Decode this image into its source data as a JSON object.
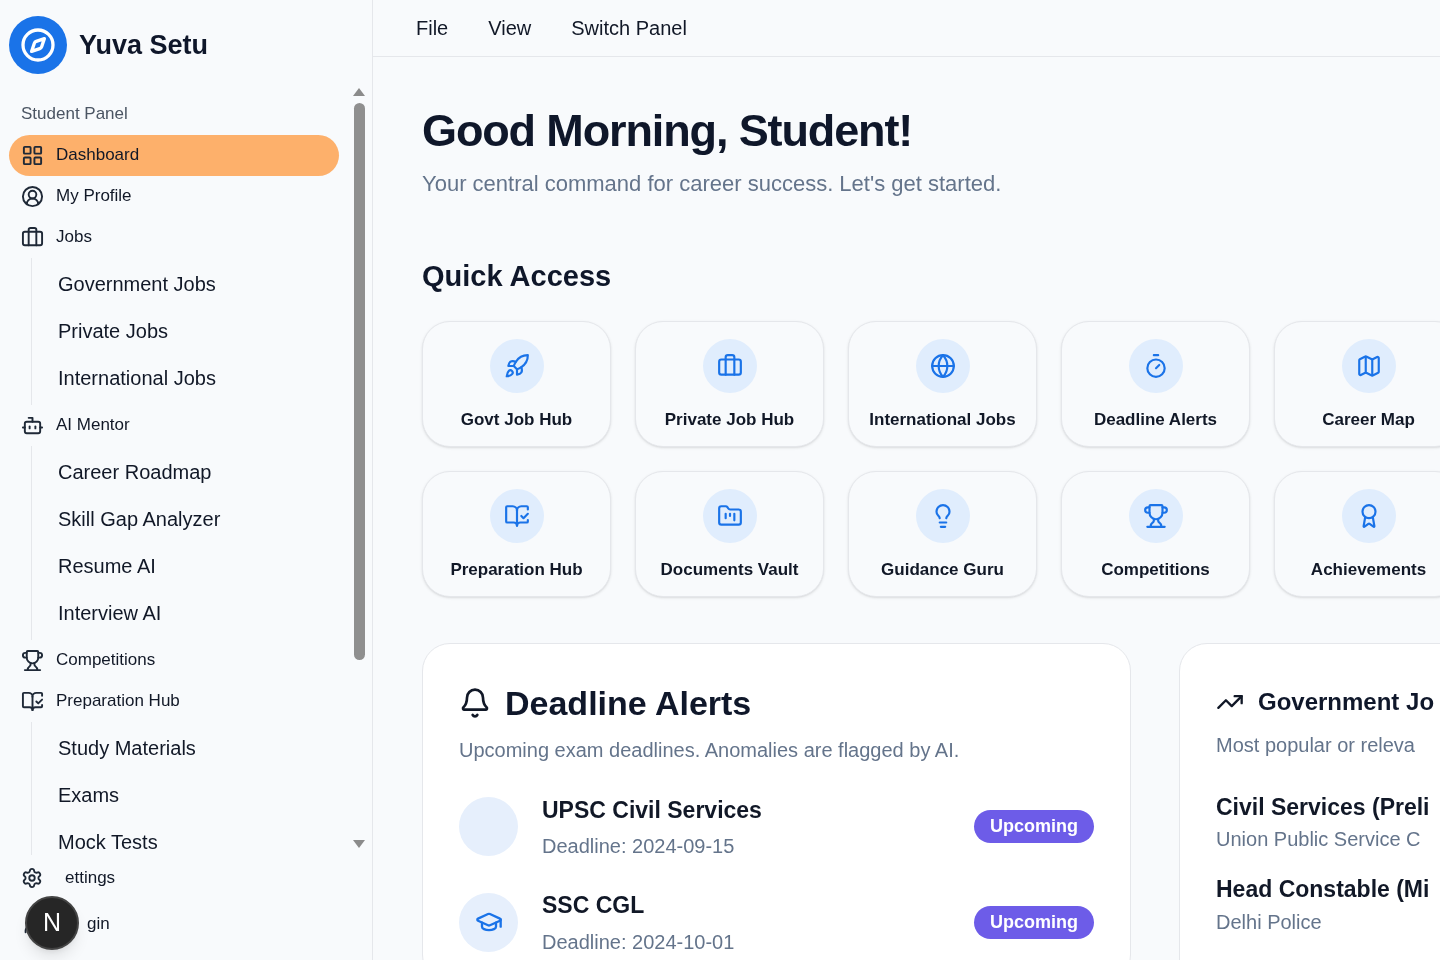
{
  "brand": {
    "name": "Yuva Setu"
  },
  "sidebar": {
    "section": "Student Panel",
    "items": [
      {
        "label": "Dashboard",
        "selected": true
      },
      {
        "label": "My Profile",
        "selected": false
      },
      {
        "label": "Jobs",
        "selected": false,
        "children": [
          {
            "label": "Government Jobs"
          },
          {
            "label": "Private Jobs"
          },
          {
            "label": "International Jobs"
          }
        ]
      },
      {
        "label": "AI Mentor",
        "selected": false,
        "children": [
          {
            "label": "Career Roadmap"
          },
          {
            "label": "Skill Gap Analyzer"
          },
          {
            "label": "Resume AI"
          },
          {
            "label": "Interview AI"
          }
        ]
      },
      {
        "label": "Competitions",
        "selected": false
      },
      {
        "label": "Preparation Hub",
        "selected": false,
        "children": [
          {
            "label": "Study Materials"
          },
          {
            "label": "Exams"
          },
          {
            "label": "Mock Tests"
          }
        ]
      }
    ],
    "footer": [
      {
        "label": "ettings"
      },
      {
        "label": "gin"
      }
    ]
  },
  "dev_badge": {
    "letter": "N"
  },
  "menu": [
    "File",
    "View",
    "Switch Panel"
  ],
  "greeting": {
    "title": "Good Morning, Student!",
    "subtitle": "Your central command for career success. Let's get started."
  },
  "quick_access": {
    "title": "Quick Access",
    "tiles": [
      {
        "label": "Govt Job Hub"
      },
      {
        "label": "Private Job Hub"
      },
      {
        "label": "International Jobs"
      },
      {
        "label": "Deadline Alerts"
      },
      {
        "label": "Career Map"
      },
      {
        "label": "Preparation Hub"
      },
      {
        "label": "Documents Vault"
      },
      {
        "label": "Guidance Guru"
      },
      {
        "label": "Competitions"
      },
      {
        "label": "Achievements"
      }
    ]
  },
  "deadline_alerts": {
    "title": "Deadline Alerts",
    "subtitle": "Upcoming exam deadlines. Anomalies are flagged by AI.",
    "items": [
      {
        "kind": "blank",
        "name": "UPSC Civil Services",
        "deadline": "Deadline: 2024-09-15",
        "status": "Upcoming"
      },
      {
        "kind": "exam",
        "name": "SSC CGL",
        "deadline": "Deadline: 2024-10-01",
        "status": "Upcoming"
      }
    ]
  },
  "government_jobs": {
    "title": "Government Jo",
    "subtitle": "Most popular or releva",
    "items": [
      {
        "name": "Civil Services (Preli",
        "org": "Union Public Service C"
      },
      {
        "name": "Head Constable (Mi",
        "org": "Delhi Police"
      }
    ]
  }
}
